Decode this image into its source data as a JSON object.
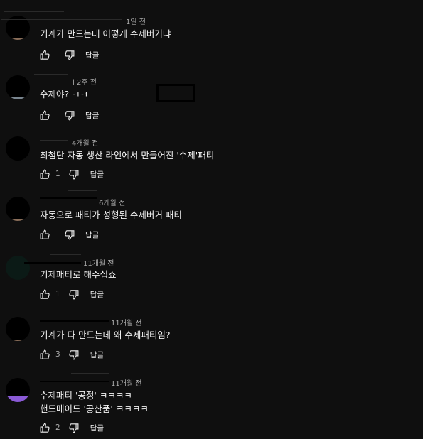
{
  "comments": [
    {
      "time": "1일 전",
      "text": "기계가  만드는데 어떻게 수제버거냐",
      "likes": "",
      "reply": "답글"
    },
    {
      "time": "l 2주 전",
      "text": "수제야? ㅋㅋ",
      "likes": "",
      "reply": "답글"
    },
    {
      "time": "4개월 전",
      "text": "최첨단 자동 생산 라인에서 만들어진 '수제'패티",
      "likes": "1",
      "reply": "답글"
    },
    {
      "time": "6개월 전",
      "text": "자동으로 패티가 성형된 수제버거 패티",
      "likes": "",
      "reply": "답글"
    },
    {
      "time": "11개월 전",
      "text": "기제패티로 해주십쇼",
      "likes": "1",
      "reply": "답글"
    },
    {
      "time": "11개월 전",
      "text": "기계가 다 만드는데 왜 수제패티임?",
      "likes": "3",
      "reply": "답글"
    },
    {
      "time": "11개월 전",
      "text": "수제패티 '공정' ㅋㅋㅋㅋ",
      "text2": "핸드메이드 '공산품' ㅋㅋㅋㅋ",
      "likes": "2",
      "reply": "답글"
    }
  ]
}
